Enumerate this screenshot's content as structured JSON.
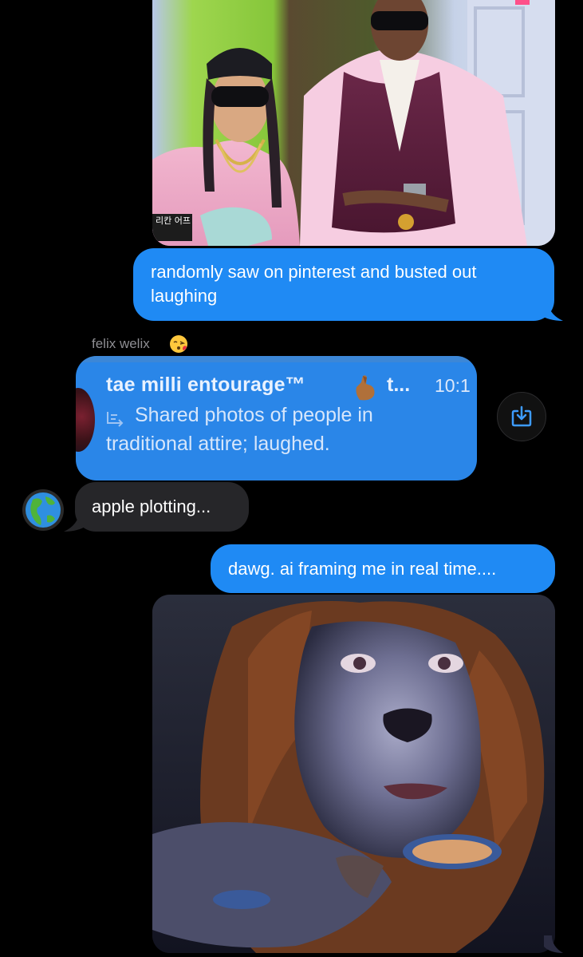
{
  "thread": {
    "photo_1": {
      "sign_text": "리칸 어프"
    },
    "message_pinterest": "randomly saw on pinterest and busted out laughing",
    "sender": {
      "name": "felix welix",
      "emoji": "face-blowing-kiss-icon"
    },
    "reply_card": {
      "title": "tae milli entourage™",
      "title_emoji": "hand-with-index-finger-and-thumb-crossed-icon",
      "title_rest": "t...",
      "time": "10:1",
      "summary_line1": "Shared photos of people in",
      "summary_line2": "traditional attire; laughed."
    },
    "save_button": {
      "icon": "save-to-device-icon"
    },
    "message_apple": "apple plotting...",
    "message_apple_avatar": "globe-americas-icon",
    "message_dawg": "dawg. ai framing me in real time....",
    "photo_2": {
      "icon": "ai-generated-image"
    }
  },
  "colors": {
    "background": "#000000",
    "outgoing_bubble": "#1f8af4",
    "incoming_bubble": "#262629",
    "sender_name": "#8e8e93",
    "reply_card": "#2a86e8"
  }
}
